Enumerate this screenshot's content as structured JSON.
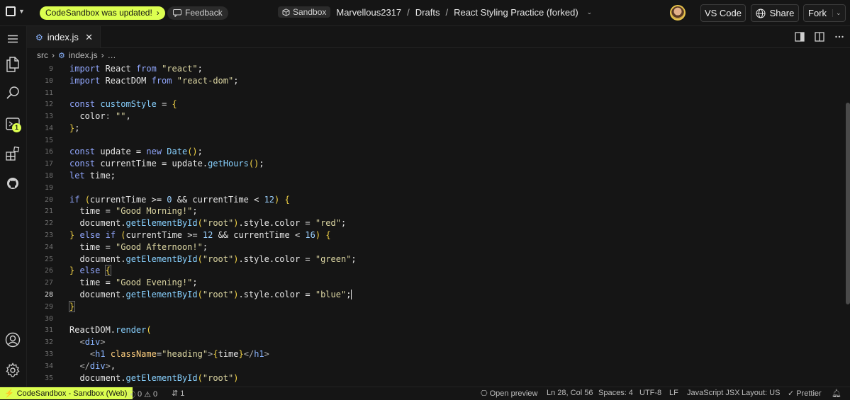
{
  "topbar": {
    "update_notice": "CodeSandbox was updated!",
    "update_arrow": "›",
    "feedback": "Feedback",
    "breadcrumb": {
      "badge": "Sandbox",
      "user": "Marvellous2317",
      "sep1": "/",
      "folder": "Drafts",
      "sep2": "/",
      "project": "React Styling Practice (forked)"
    },
    "buttons": {
      "vscode": "VS Code",
      "share": "Share",
      "fork": "Fork"
    }
  },
  "tab": {
    "filename": "index.js",
    "close": "✕"
  },
  "path": {
    "folder": "src",
    "sep": "›",
    "file": "index.js",
    "more": "…"
  },
  "activity": {
    "badge_count": "1"
  },
  "editor": {
    "current_line": "28",
    "lines": [
      {
        "n": "9"
      },
      {
        "n": "10"
      },
      {
        "n": "11"
      },
      {
        "n": "12"
      },
      {
        "n": "13"
      },
      {
        "n": "14"
      },
      {
        "n": "15"
      },
      {
        "n": "16"
      },
      {
        "n": "17"
      },
      {
        "n": "18"
      },
      {
        "n": "19"
      },
      {
        "n": "20"
      },
      {
        "n": "21"
      },
      {
        "n": "22"
      },
      {
        "n": "23"
      },
      {
        "n": "24"
      },
      {
        "n": "25"
      },
      {
        "n": "26"
      },
      {
        "n": "27"
      },
      {
        "n": "28"
      },
      {
        "n": "29"
      },
      {
        "n": "30"
      },
      {
        "n": "31"
      },
      {
        "n": "32"
      },
      {
        "n": "33"
      },
      {
        "n": "34"
      },
      {
        "n": "35"
      }
    ],
    "code": [
      "import React from \"react\";",
      "import ReactDOM from \"react-dom\";",
      "",
      "const customStyle = {",
      "  color: \"\",",
      "};",
      "",
      "const update = new Date();",
      "const currentTime = update.getHours();",
      "let time;",
      "",
      "if (currentTime >= 0 && currentTime < 12) {",
      "  time = \"Good Morning!\";",
      "  document.getElementById(\"root\").style.color = \"red\";",
      "} else if (currentTime >= 12 && currentTime < 16) {",
      "  time = \"Good Afternoon!\";",
      "  document.getElementById(\"root\").style.color = \"green\";",
      "} else {",
      "  time = \"Good Evening!\";",
      "  document.getElementById(\"root\").style.color = \"blue\";",
      "}",
      "",
      "ReactDOM.render(",
      "  <div>",
      "    <h1 className=\"heading\">{time}</h1>",
      "  </div>,",
      "  document.getElementById(\"root\")"
    ]
  },
  "status": {
    "remote": "CodeSandbox - Sandbox (Web)",
    "errors": "0",
    "warnings": "0",
    "ports": "1",
    "open_preview": "Open preview",
    "cursor": "Ln 28, Col 56",
    "spaces": "Spaces: 4",
    "encoding": "UTF-8",
    "eol": "LF",
    "language": "JavaScript JSX",
    "layout": "Layout: US",
    "prettier": "Prettier"
  },
  "colors": {
    "accent": "#dcff50",
    "background": "#151515",
    "keyword": "#92a8ff",
    "string": "#dcd6a2",
    "bracket": "#f5d547"
  }
}
